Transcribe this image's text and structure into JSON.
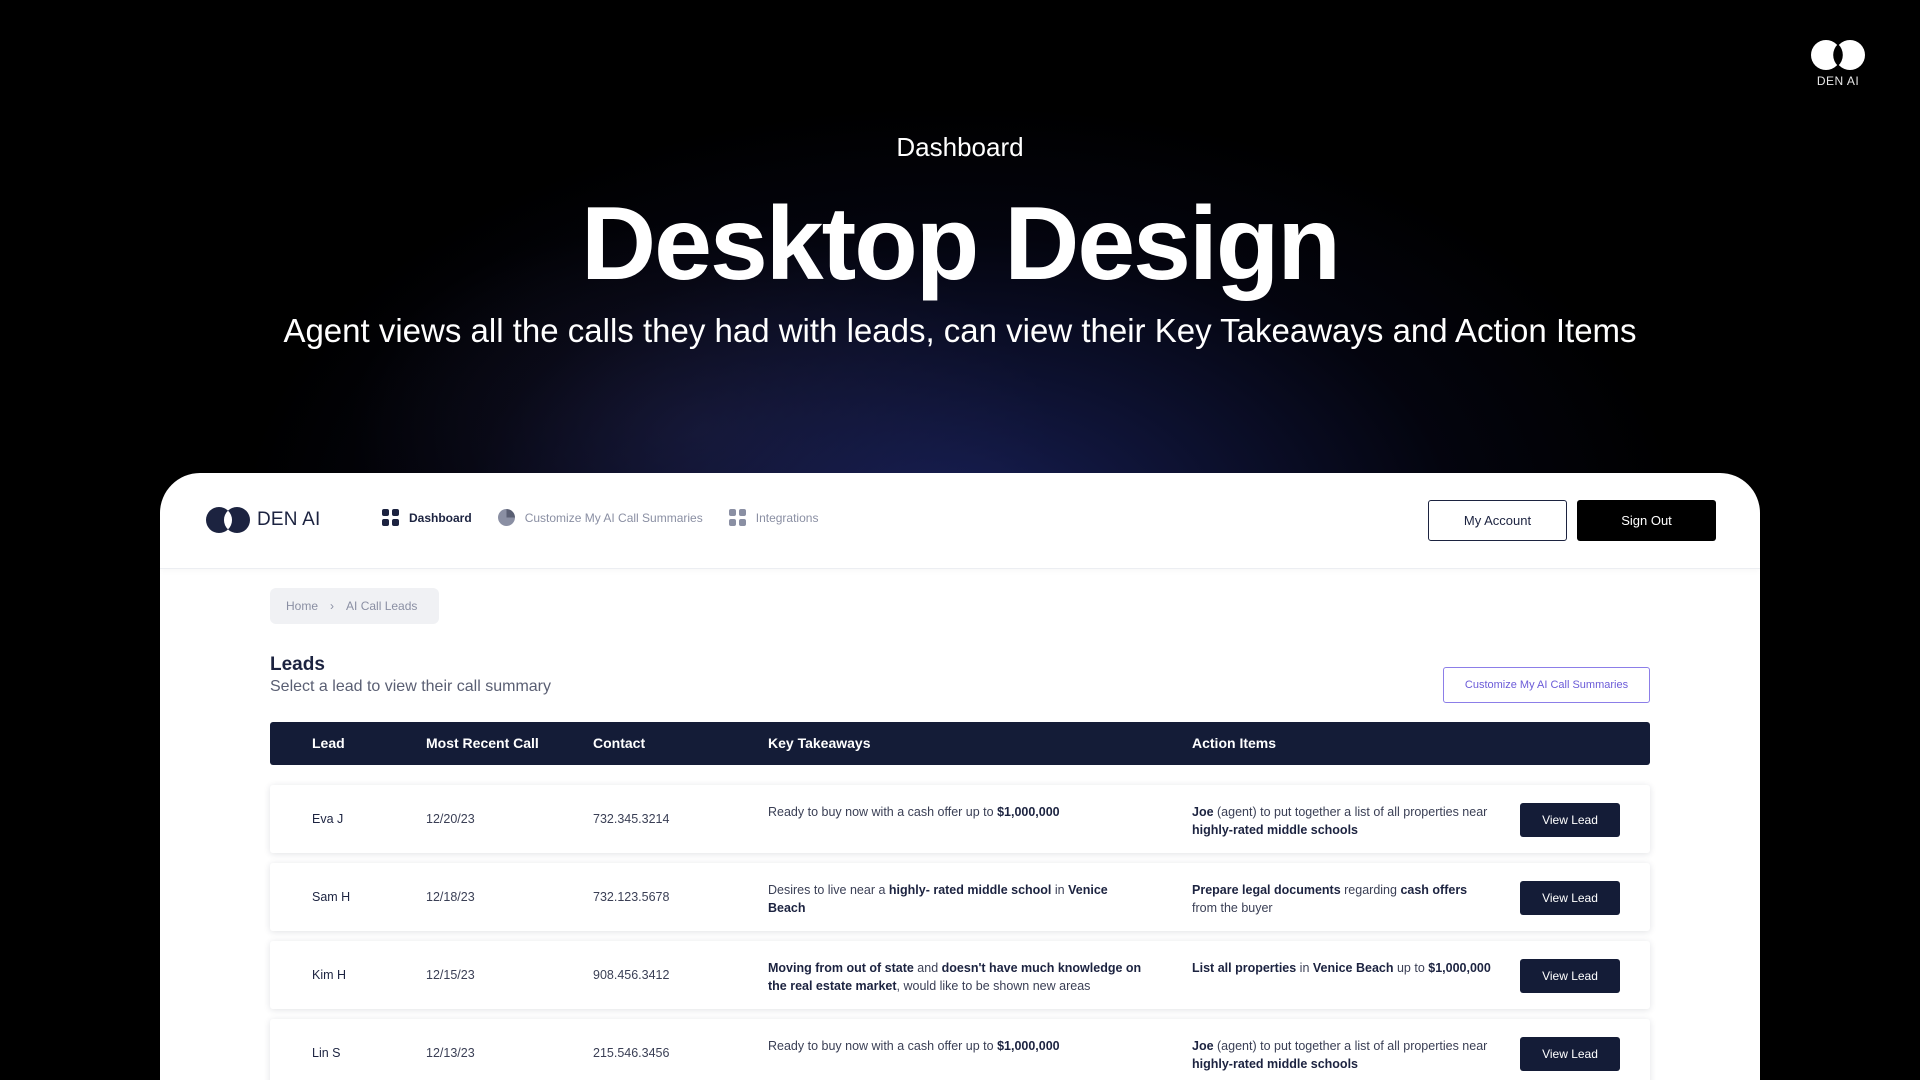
{
  "corner_brand": {
    "text": "DEN AI"
  },
  "hero": {
    "eyebrow": "Dashboard",
    "title": "Desktop Design",
    "subtitle": "Agent views all the calls they had with leads, can view their Key Takeaways and Action Items"
  },
  "app": {
    "logo_text": "DEN AI",
    "nav": [
      {
        "label": "Dashboard",
        "icon": "grid-icon",
        "active": true
      },
      {
        "label": "Customize My AI Call Summaries",
        "icon": "pie-chart-icon",
        "active": false
      },
      {
        "label": "Integrations",
        "icon": "grid-icon",
        "active": false
      }
    ],
    "account_button": "My Account",
    "signout_button": "Sign Out",
    "breadcrumb": [
      "Home",
      "AI Call Leads"
    ],
    "section_title": "Leads",
    "section_subtitle": "Select a lead to view their call summary",
    "customize_button": "Customize My AI Call Summaries",
    "table": {
      "headers": [
        "Lead",
        "Most Recent Call",
        "Contact",
        "Key Takeaways",
        "Action Items"
      ],
      "view_label": "View Lead",
      "rows": [
        {
          "lead": "Eva J",
          "date": "12/20/23",
          "contact": "732.345.3214",
          "takeaways": [
            {
              "t": "Ready to buy now with a cash offer up to ",
              "b": false
            },
            {
              "t": "$1,000,000",
              "b": true
            }
          ],
          "actions": [
            {
              "t": "Joe",
              "b": true
            },
            {
              "t": " (agent) to put together a list of all properties near ",
              "b": false
            },
            {
              "t": "highly-rated middle schools",
              "b": true
            }
          ]
        },
        {
          "lead": "Sam H",
          "date": "12/18/23",
          "contact": "732.123.5678",
          "takeaways": [
            {
              "t": "Desires to live near a ",
              "b": false
            },
            {
              "t": "highly- rated middle school",
              "b": true
            },
            {
              "t": " in ",
              "b": false
            },
            {
              "t": "Venice Beach",
              "b": true
            }
          ],
          "actions": [
            {
              "t": "Prepare legal documents",
              "b": true
            },
            {
              "t": " regarding ",
              "b": false
            },
            {
              "t": "cash offers",
              "b": true
            },
            {
              "t": " from the buyer",
              "b": false
            }
          ]
        },
        {
          "lead": "Kim H",
          "date": "12/15/23",
          "contact": "908.456.3412",
          "takeaways": [
            {
              "t": "Moving from out of state",
              "b": true
            },
            {
              "t": " and ",
              "b": false
            },
            {
              "t": "doesn't have much knowledge on the real estate market",
              "b": true
            },
            {
              "t": ", would like to be shown new areas",
              "b": false
            }
          ],
          "actions": [
            {
              "t": "List all properties",
              "b": true
            },
            {
              "t": " in ",
              "b": false
            },
            {
              "t": "Venice Beach",
              "b": true
            },
            {
              "t": " up to ",
              "b": false
            },
            {
              "t": "$1,000,000",
              "b": true
            }
          ]
        },
        {
          "lead": "Lin S",
          "date": "12/13/23",
          "contact": "215.546.3456",
          "takeaways": [
            {
              "t": "Ready to buy now with a cash offer up to ",
              "b": false
            },
            {
              "t": "$1,000,000",
              "b": true
            }
          ],
          "actions": [
            {
              "t": "Joe",
              "b": true
            },
            {
              "t": " (agent) to put together a list of all properties near ",
              "b": false
            },
            {
              "t": "highly-rated middle schools",
              "b": true
            }
          ]
        }
      ]
    }
  }
}
